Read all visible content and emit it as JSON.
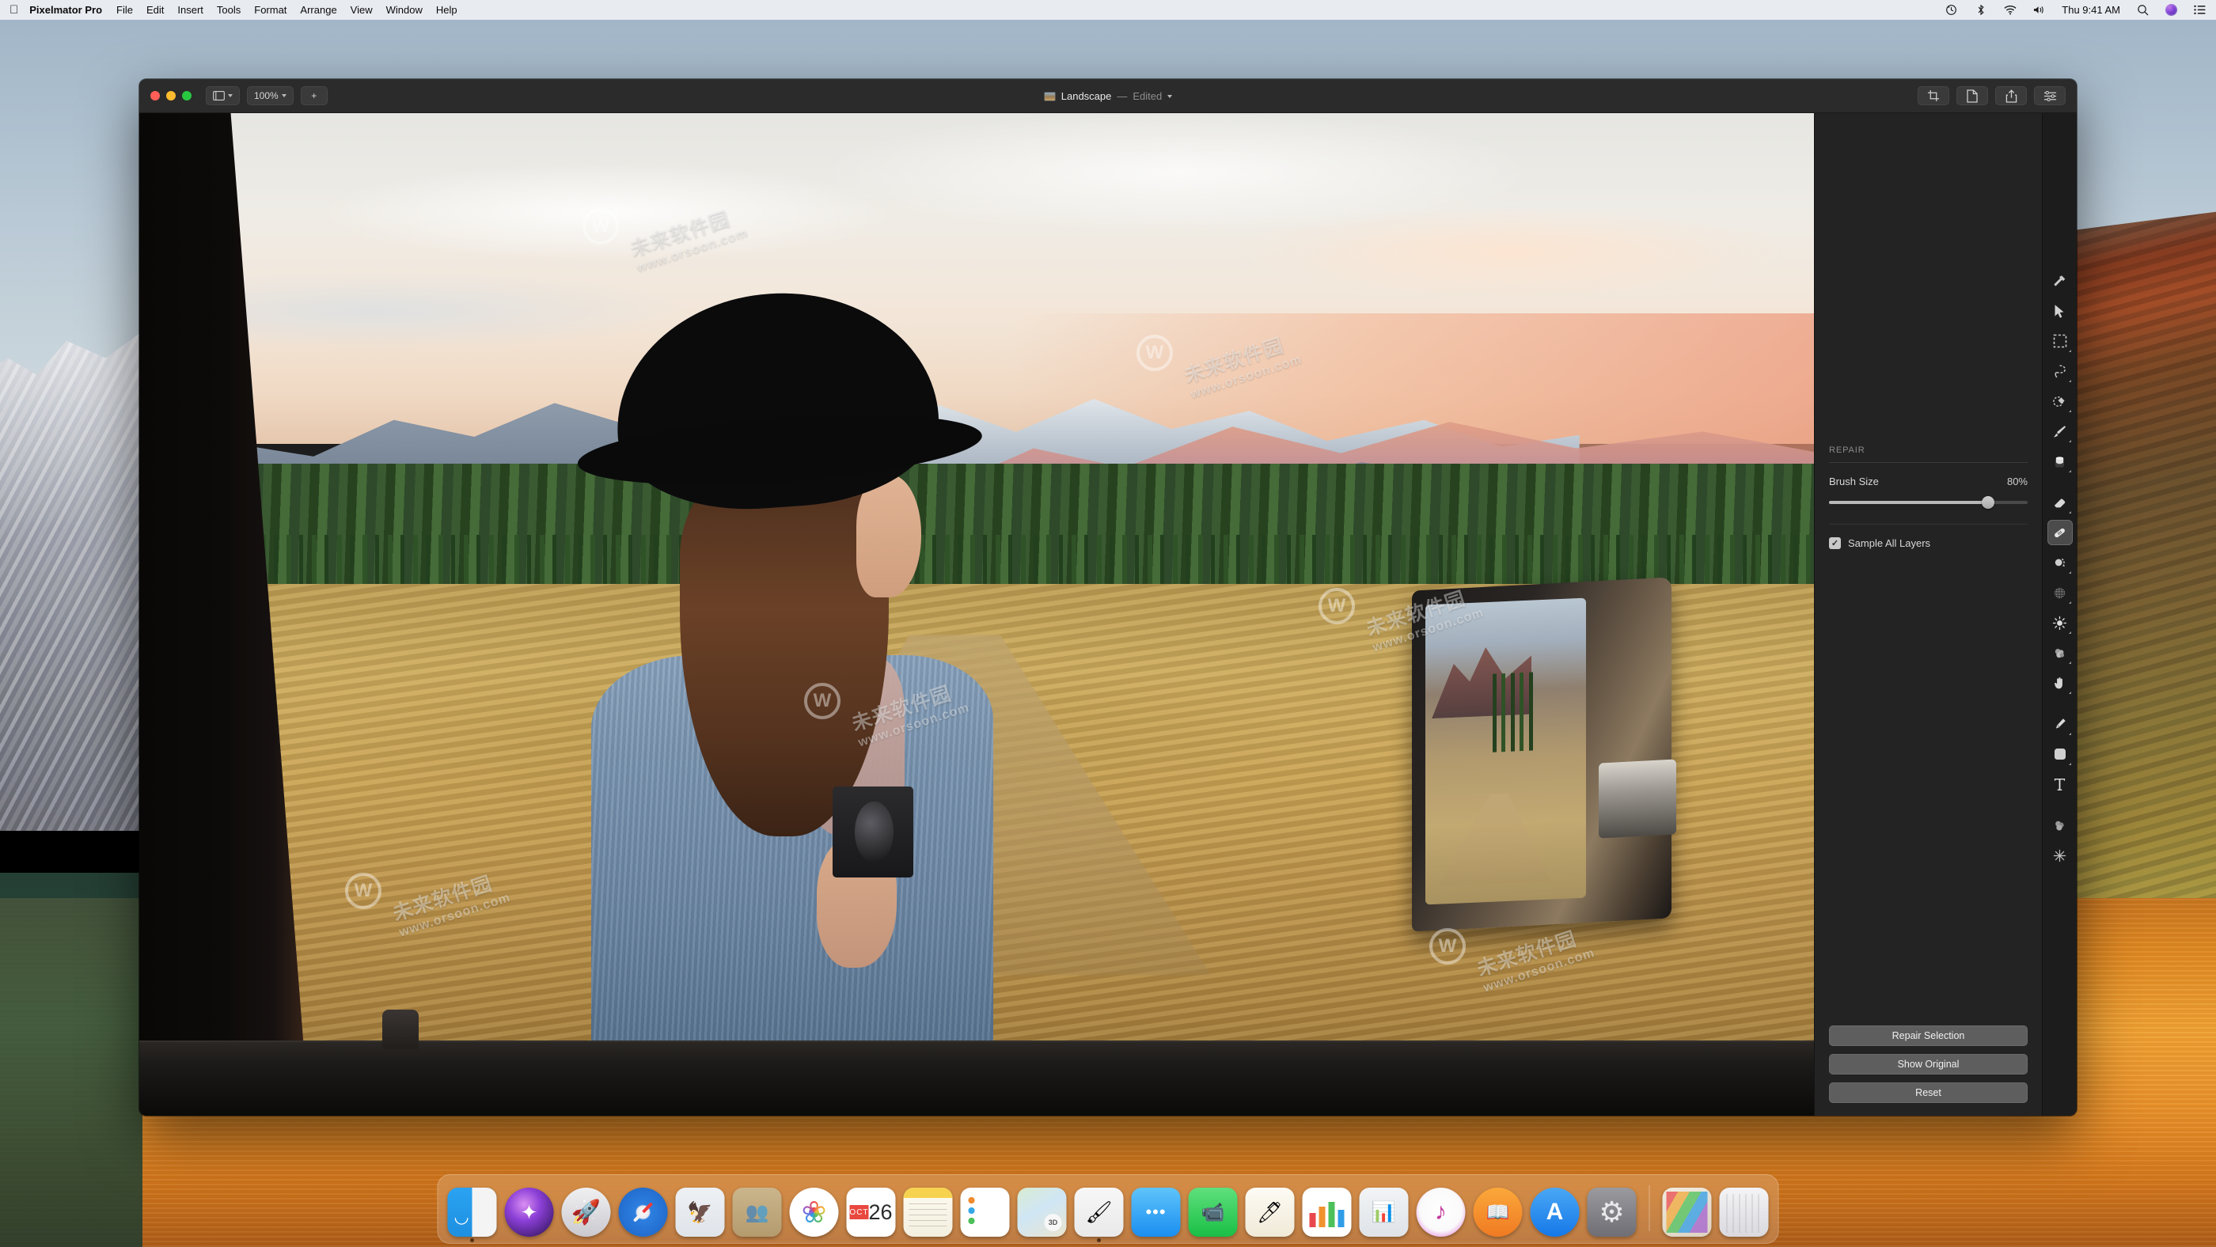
{
  "menubar": {
    "apple_logo": "apple-logo",
    "app_name": "Pixelmator Pro",
    "items": [
      "File",
      "Edit",
      "Insert",
      "Tools",
      "Format",
      "Arrange",
      "View",
      "Window",
      "Help"
    ],
    "status_icons": [
      "time-machine-icon",
      "bluetooth-icon",
      "wifi-icon",
      "volume-icon"
    ],
    "clock": "Thu 9:41 AM",
    "search_icon": "search-icon",
    "siri_icon": "siri-icon",
    "control_center_icon": "control-center-icon"
  },
  "window": {
    "traffic_lights": [
      "close",
      "minimize",
      "zoom"
    ],
    "toolbar_left": {
      "layout_button": "layout-icon",
      "zoom_value": "100%",
      "add_button": "+"
    },
    "document": {
      "thumbnail": "document-thumbnail",
      "name": "Landscape",
      "separator": "—",
      "state": "Edited",
      "chevron": "chevron-down-icon"
    },
    "toolbar_right": [
      "crop-icon",
      "document-icon",
      "share-icon",
      "adjustments-icon"
    ]
  },
  "sidebar": {
    "section_title": "REPAIR",
    "brush_size": {
      "label": "Brush Size",
      "value": "80%",
      "percent": 80
    },
    "sample_all_layers": {
      "label": "Sample All Layers",
      "checked": true,
      "check_glyph": "✓"
    },
    "buttons": [
      {
        "label": "Repair Selection",
        "name": "repair-selection-button"
      },
      {
        "label": "Show Original",
        "name": "show-original-button"
      },
      {
        "label": "Reset",
        "name": "reset-button"
      }
    ]
  },
  "toolrail": {
    "tools": [
      {
        "name": "effects-hammer-tool",
        "active": false,
        "submenu": false
      },
      {
        "name": "arrange-move-tool",
        "active": false,
        "submenu": false
      },
      {
        "name": "rectangular-marquee-tool",
        "active": false,
        "submenu": true
      },
      {
        "name": "lasso-select-tool",
        "active": false,
        "submenu": true
      },
      {
        "name": "quick-selection-tool",
        "active": false,
        "submenu": true
      },
      {
        "name": "paint-brush-tool",
        "active": false,
        "submenu": true
      },
      {
        "name": "paint-bucket-tool",
        "active": false,
        "submenu": true
      },
      {
        "name": "eraser-tool",
        "active": false,
        "submenu": true
      },
      {
        "name": "repair-tool",
        "active": true,
        "submenu": false
      },
      {
        "name": "clone-stamp-tool",
        "active": false,
        "submenu": true
      },
      {
        "name": "blur-noise-tool",
        "active": false,
        "submenu": true
      },
      {
        "name": "lighten-tool",
        "active": false,
        "submenu": true
      },
      {
        "name": "smudge-tool",
        "active": false,
        "submenu": true
      },
      {
        "name": "warp-hand-tool",
        "active": false,
        "submenu": true
      },
      {
        "name": "pen-tool",
        "active": false,
        "submenu": true
      },
      {
        "name": "shape-tool",
        "active": false,
        "submenu": true
      },
      {
        "name": "type-tool",
        "active": false,
        "submenu": false
      },
      {
        "name": "color-adjust-tool",
        "active": false,
        "submenu": false
      },
      {
        "name": "effects-sparkle-tool",
        "active": false,
        "submenu": false
      }
    ]
  },
  "canvas": {
    "image_title": "Landscape photo - woman in black hat with camera looking at mountains through car window",
    "watermarks": [
      {
        "cn": "未来软件园",
        "en": "www.orsoon.com"
      }
    ]
  },
  "dock": {
    "items": [
      {
        "name": "dock-finder",
        "label": "Finder",
        "icon": "ic-finder",
        "shape": "rounded",
        "running": true
      },
      {
        "name": "dock-siri",
        "label": "Siri",
        "icon": "ic-siri",
        "shape": "circle",
        "running": false
      },
      {
        "name": "dock-launchpad",
        "label": "Launchpad",
        "icon": "ic-launchpad",
        "shape": "circle",
        "running": false
      },
      {
        "name": "dock-safari",
        "label": "Safari",
        "icon": "ic-safari",
        "shape": "circle",
        "running": false
      },
      {
        "name": "dock-mail",
        "label": "Mail",
        "icon": "ic-mail",
        "shape": "rounded",
        "running": false
      },
      {
        "name": "dock-contacts",
        "label": "Contacts",
        "icon": "ic-contacts",
        "shape": "rounded",
        "running": false
      },
      {
        "name": "dock-photos",
        "label": "Photos",
        "icon": "ic-photos",
        "shape": "circle",
        "running": false
      },
      {
        "name": "dock-calendar",
        "label": "Calendar",
        "icon": "ic-calendar",
        "shape": "rounded",
        "running": false,
        "month": "OCT",
        "day": "26"
      },
      {
        "name": "dock-notes",
        "label": "Notes",
        "icon": "ic-notes",
        "shape": "rounded",
        "running": false
      },
      {
        "name": "dock-reminders",
        "label": "Reminders",
        "icon": "ic-reminders",
        "shape": "rounded",
        "running": false
      },
      {
        "name": "dock-maps",
        "label": "Maps",
        "icon": "ic-maps",
        "shape": "rounded",
        "running": false
      },
      {
        "name": "dock-pixelmator",
        "label": "Pixelmator Pro",
        "icon": "ic-pixelmator",
        "shape": "rounded",
        "running": true
      },
      {
        "name": "dock-messages",
        "label": "Messages",
        "icon": "ic-messages",
        "shape": "rounded",
        "running": false
      },
      {
        "name": "dock-facetime",
        "label": "FaceTime",
        "icon": "ic-facetime",
        "shape": "rounded",
        "running": false
      },
      {
        "name": "dock-pages",
        "label": "Pages",
        "icon": "ic-pages",
        "shape": "rounded",
        "running": false
      },
      {
        "name": "dock-numbers",
        "label": "Numbers",
        "icon": "ic-numbers",
        "shape": "rounded",
        "running": false
      },
      {
        "name": "dock-keynote",
        "label": "Keynote",
        "icon": "ic-keynote",
        "shape": "rounded",
        "running": false
      },
      {
        "name": "dock-itunes",
        "label": "iTunes",
        "icon": "ic-itunes",
        "shape": "circle",
        "running": false
      },
      {
        "name": "dock-books",
        "label": "Books",
        "icon": "ic-books",
        "shape": "circle",
        "running": false
      },
      {
        "name": "dock-appstore",
        "label": "App Store",
        "icon": "ic-appstore",
        "shape": "circle",
        "running": false
      },
      {
        "name": "dock-system-preferences",
        "label": "System Preferences",
        "icon": "ic-sysprefs",
        "shape": "rounded",
        "running": false
      }
    ],
    "separator": true,
    "right_items": [
      {
        "name": "dock-stack",
        "label": "Downloads Stack",
        "icon": "ic-stack",
        "shape": "rounded"
      },
      {
        "name": "dock-trash",
        "label": "Trash",
        "icon": "ic-trash",
        "shape": "rounded"
      }
    ]
  },
  "colors": {
    "window_chrome": "#2b2b2b",
    "sidebar_bg": "#232323",
    "toolrail_bg": "#1c1c1c",
    "accent_button": "#5e5e5e",
    "slider_fill": "#b9b9b9",
    "menubar_bg": "#eef0f3"
  }
}
